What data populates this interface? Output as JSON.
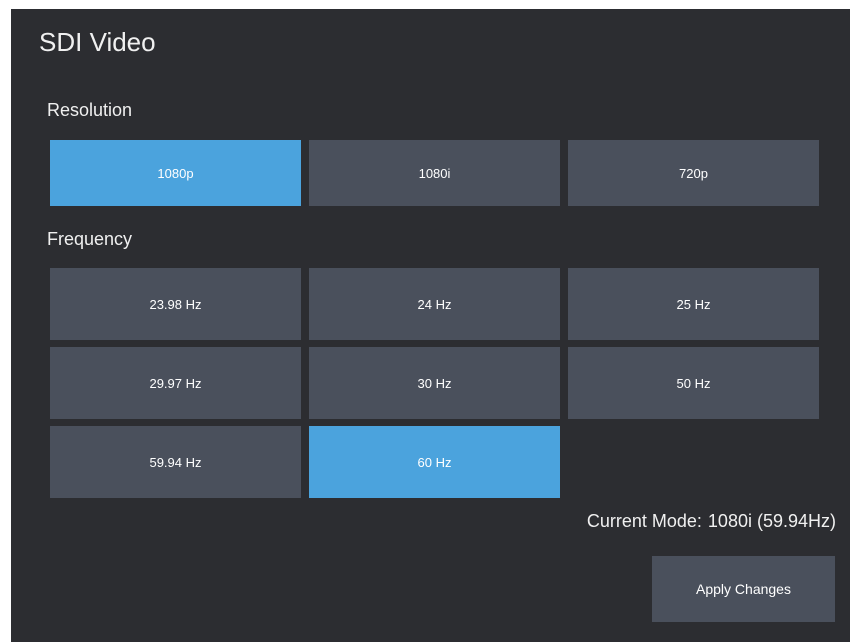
{
  "panel": {
    "title": "SDI Video"
  },
  "resolution": {
    "label": "Resolution",
    "options": [
      "1080p",
      "1080i",
      "720p"
    ],
    "selected": "1080p"
  },
  "frequency": {
    "label": "Frequency",
    "options": [
      "23.98 Hz",
      "24 Hz",
      "25 Hz",
      "29.97 Hz",
      "30 Hz",
      "50 Hz",
      "59.94 Hz",
      "60 Hz"
    ],
    "selected": "60 Hz"
  },
  "current_mode": {
    "label": "Current Mode:",
    "value": "1080i (59.94Hz)"
  },
  "apply_label": "Apply Changes",
  "colors": {
    "panel_bg": "#2c2d31",
    "button_bg": "#4a505c",
    "selected_bg": "#4ba3dd",
    "text": "#f0f0f0"
  }
}
